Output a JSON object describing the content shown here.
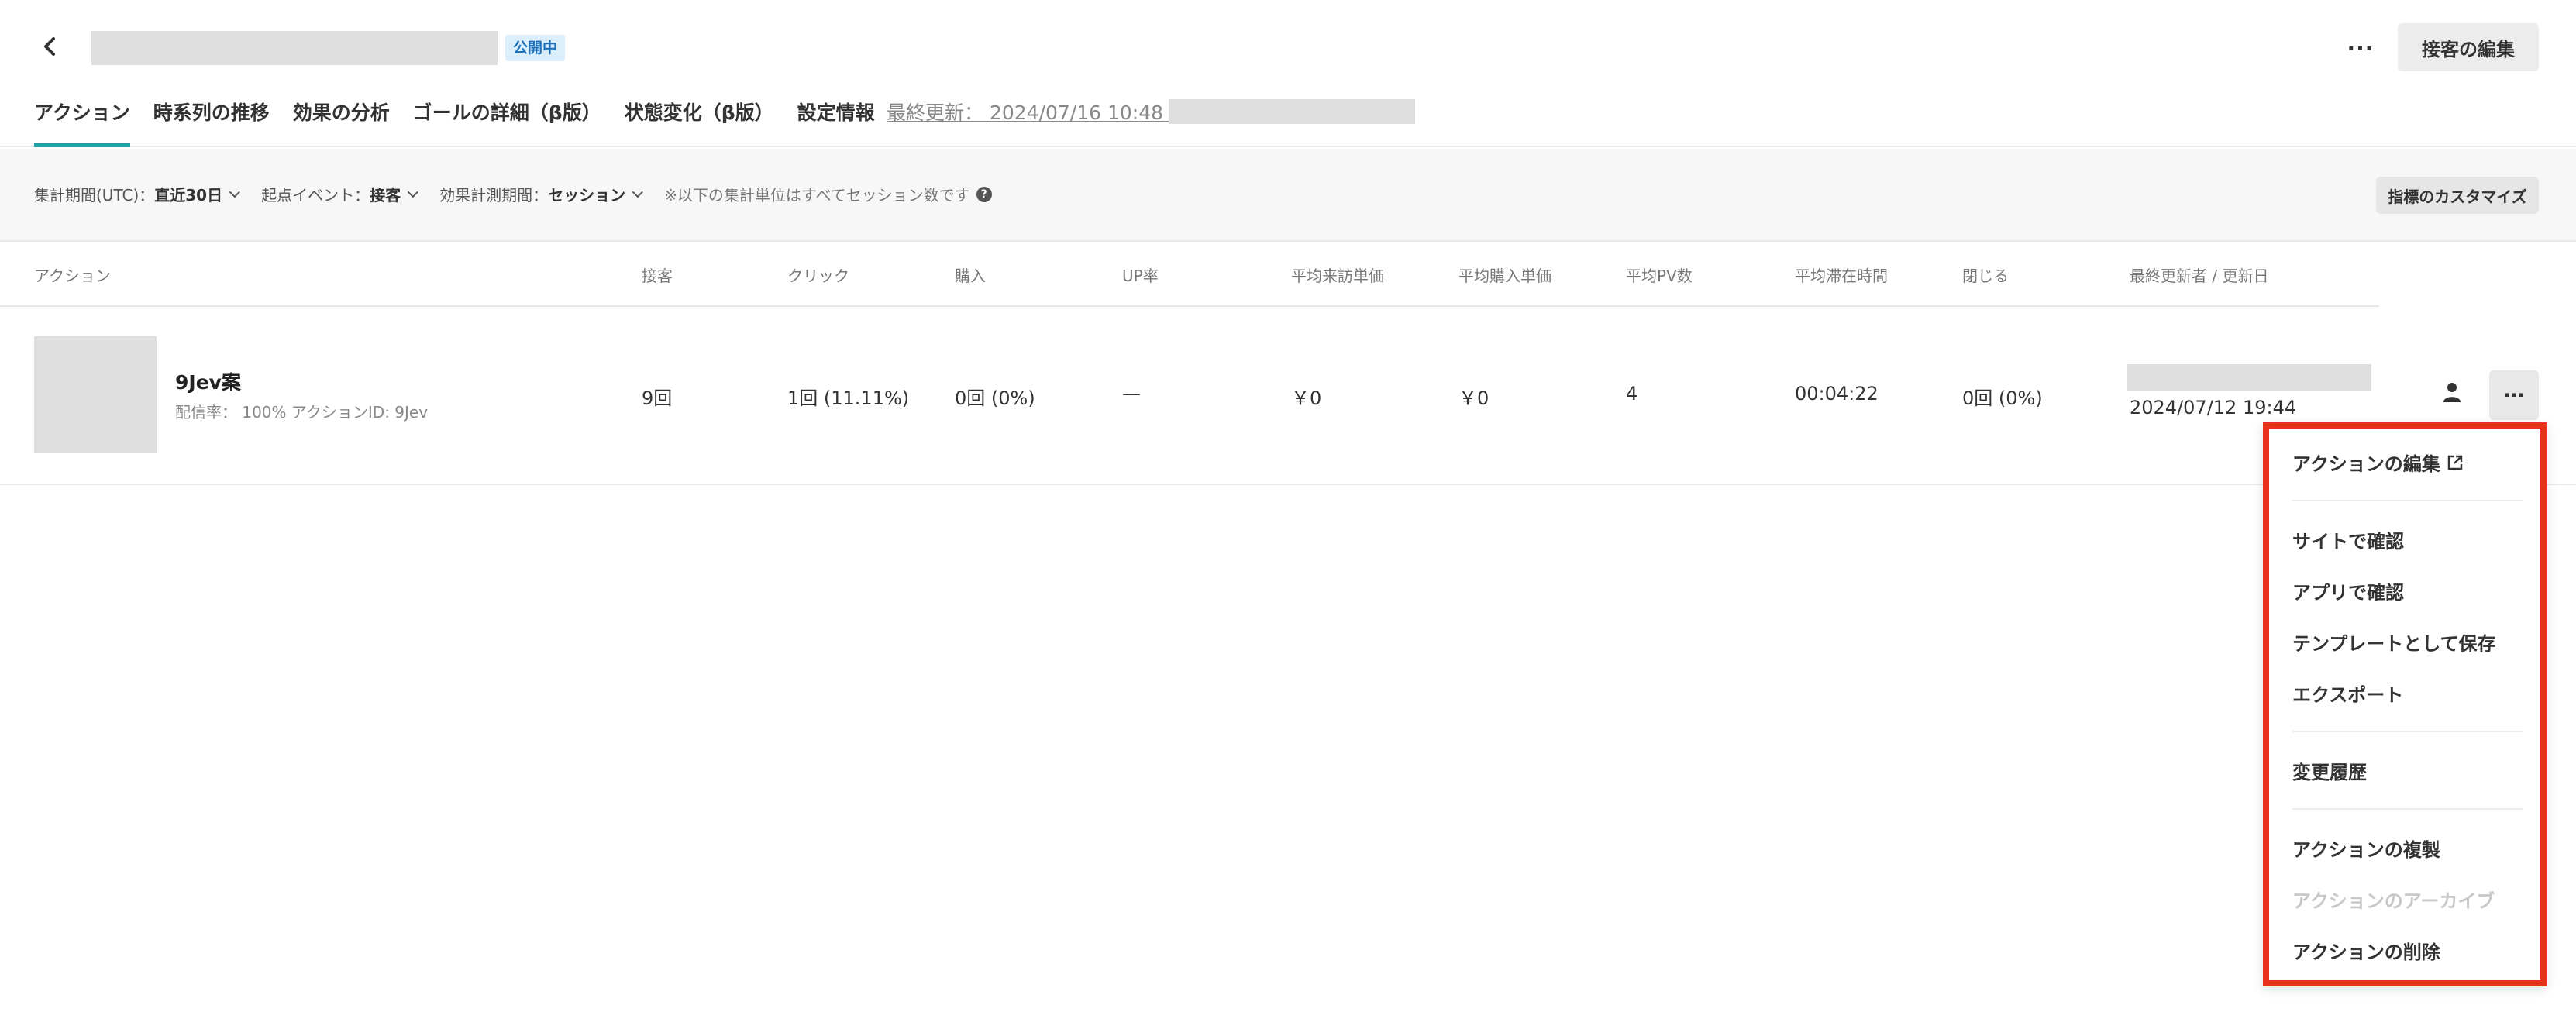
{
  "header": {
    "status_badge": "公開中",
    "more_label": "···",
    "edit_button": "接客の編集"
  },
  "tabs": [
    {
      "label": "アクション",
      "active": true
    },
    {
      "label": "時系列の推移",
      "active": false
    },
    {
      "label": "効果の分析",
      "active": false
    },
    {
      "label": "ゴールの詳細（β版）",
      "active": false
    },
    {
      "label": "状態変化（β版）",
      "active": false
    },
    {
      "label": "設定情報",
      "active": false
    }
  ],
  "last_updated": "最終更新： 2024/07/16 10:48 by",
  "filters": {
    "period_label": "集計期間(UTC)：",
    "period_value": "直近30日",
    "start_event_label": "起点イベント：",
    "start_event_value": "接客",
    "measure_label": "効果計測期間：",
    "measure_value": "セッション",
    "note": "※以下の集計単位はすべてセッション数です",
    "help_icon": "?",
    "customize_button": "指標のカスタマイズ"
  },
  "table": {
    "columns": [
      "アクション",
      "接客",
      "クリック",
      "購入",
      "UP率",
      "平均来訪単価",
      "平均購入単価",
      "平均PV数",
      "平均滞在時間",
      "閉じる",
      "最終更新者 / 更新日"
    ],
    "rows": [
      {
        "name": "9Jev案",
        "sub": "配信率： 100% アクションID: 9Jev",
        "cells": [
          "9回",
          "1回 (11.11%)",
          "0回 (0%)",
          "—",
          "￥0",
          "￥0",
          "4",
          "00:04:22",
          "0回 (0%)"
        ],
        "updated_date": "2024/07/12 19:44",
        "more_label": "···"
      }
    ]
  },
  "menu": {
    "items": [
      {
        "label": "アクションの編集",
        "disabled": false
      },
      {
        "label": "サイトで確認",
        "disabled": false
      },
      {
        "label": "アプリで確認",
        "disabled": false
      },
      {
        "label": "テンプレートとして保存",
        "disabled": false
      },
      {
        "label": "エクスポート",
        "disabled": false
      },
      {
        "label": "変更履歴",
        "disabled": false
      },
      {
        "label": "アクションの複製",
        "disabled": false
      },
      {
        "label": "アクションのアーカイブ",
        "disabled": true
      },
      {
        "label": "アクションの削除",
        "disabled": false
      }
    ]
  },
  "colors": {
    "accent_tab": "#1fa1a6",
    "menu_highlight": "#e8321c",
    "badge_bg": "#dbeefb",
    "badge_text": "#1d6fb8"
  }
}
